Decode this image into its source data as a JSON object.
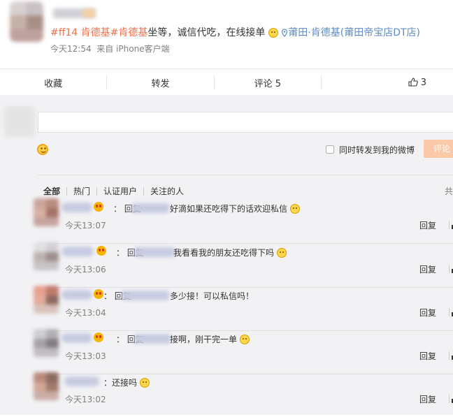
{
  "post": {
    "topic": "#ff14 肯德基#",
    "topic2": "肯德基",
    "text_rest": "坐等，诚信代吃，在线接单",
    "location": "莆田·肯德基(莆田帝宝店DT店)",
    "time": "今天12:54",
    "source": "来自 iPhone客户端"
  },
  "actions": {
    "favorite": "收藏",
    "repost": "转发",
    "comment": "评论 5",
    "like_count": "3"
  },
  "composer": {
    "repost_label": "同时转发到我的微博",
    "submit_label": "评论"
  },
  "filters": {
    "all": "全部",
    "hot": "热门",
    "verified": "认证用户",
    "following": "关注的人",
    "total": "共"
  },
  "comments": [
    {
      "reply_prefix": "回复",
      "text": "好滴如果还吃得下的话欢迎私信",
      "time": "今天13:07",
      "reply": "回复"
    },
    {
      "reply_prefix": "回复",
      "text": "我看看我的朋友还吃得下吗",
      "time": "今天13:06",
      "reply": "回复"
    },
    {
      "reply_prefix": "回复",
      "text": "多少接！可以私信吗！",
      "time": "今天13:04",
      "reply": "回复"
    },
    {
      "reply_prefix": "回复",
      "text": "接啊，刚干完一单",
      "time": "今天13:03",
      "reply": "回复"
    },
    {
      "reply_prefix": "",
      "text": "还接吗",
      "time": "今天13:02",
      "reply": "回复"
    }
  ]
}
